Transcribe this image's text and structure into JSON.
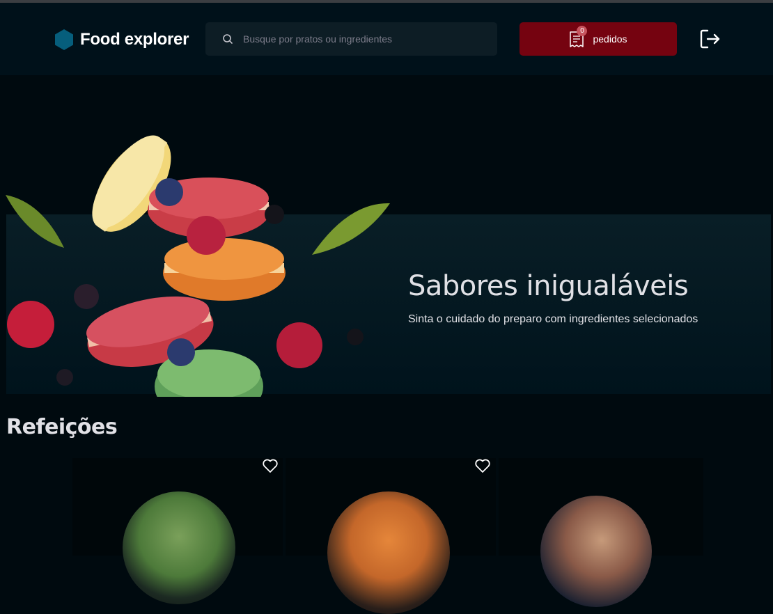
{
  "header": {
    "brand": "Food explorer",
    "search": {
      "placeholder": "Busque por pratos ou ingredientes",
      "value": ""
    },
    "orders": {
      "label": "pedidos",
      "count": "0"
    },
    "logout_icon": "sign-out-icon",
    "colors": {
      "brand_icon": "#065e7c",
      "orders_button": "#750310",
      "header_bg": "#00111a"
    }
  },
  "hero": {
    "title": "Sabores inigualáveis",
    "subtitle": "Sinta o cuidado do preparo com ingredientes selecionados"
  },
  "meals": {
    "title": "Refeições",
    "dishes": [
      {
        "favorite_icon": "heart-icon"
      },
      {
        "favorite_icon": "heart-icon"
      },
      {
        "favorite_icon": "heart-icon"
      }
    ]
  }
}
